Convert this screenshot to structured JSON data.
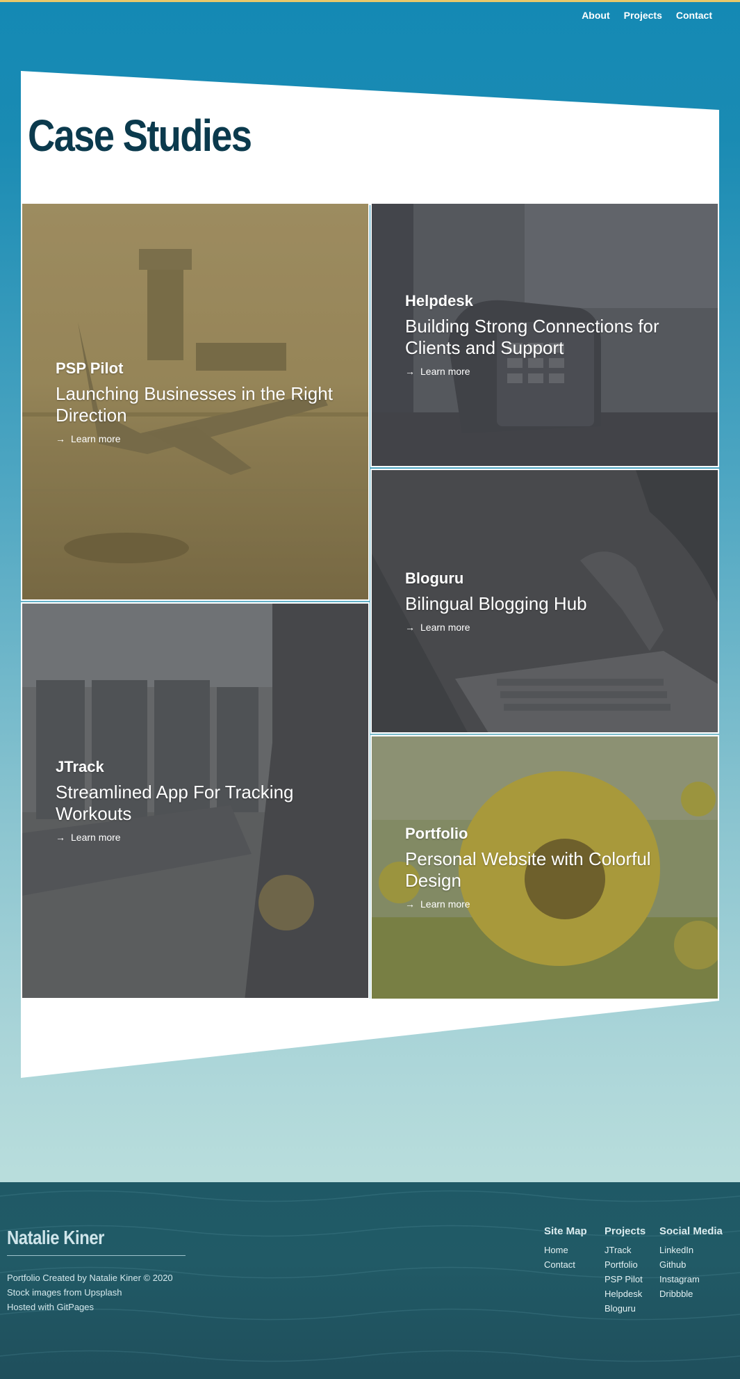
{
  "nav": {
    "items": [
      "About",
      "Projects",
      "Contact"
    ]
  },
  "page": {
    "title": "Case Studies"
  },
  "cases": [
    {
      "name": "PSP Pilot",
      "desc": "Launching Businesses in the Right Direction",
      "more": "Learn more",
      "theme": "airplane",
      "tint": "#8a7a4e"
    },
    {
      "name": "Helpdesk",
      "desc": "Building Strong Connections for Clients and Support",
      "more": "Learn more",
      "theme": "phone",
      "tint": "#4d4f55"
    },
    {
      "name": "Bloguru",
      "desc": "Bilingual Blogging Hub",
      "more": "Learn more",
      "theme": "laptop",
      "tint": "#45474b"
    },
    {
      "name": "JTrack",
      "desc": "Streamlined App For Tracking Workouts",
      "more": "Learn more",
      "theme": "gym",
      "tint": "#5a5c5e"
    },
    {
      "name": "Portfolio",
      "desc": "Personal Website with Colorful Design",
      "more": "Learn more",
      "theme": "sunflower",
      "tint": "#8d8a3e"
    }
  ],
  "footer": {
    "name": "Natalie Kiner",
    "info": [
      "Portfolio Created by Natalie Kiner © 2020",
      "Stock images from Upsplash",
      "Hosted with GitPages"
    ],
    "sitemap": {
      "title": "Site Map",
      "links": [
        "Home",
        "Contact"
      ]
    },
    "projects": {
      "title": "Projects",
      "links": [
        "JTrack",
        "Portfolio",
        "PSP Pilot",
        "Helpdesk",
        "Bloguru"
      ]
    },
    "social": {
      "title": "Social Media",
      "links": [
        "LinkedIn",
        "Github",
        "Instagram",
        "Dribbble"
      ]
    }
  }
}
